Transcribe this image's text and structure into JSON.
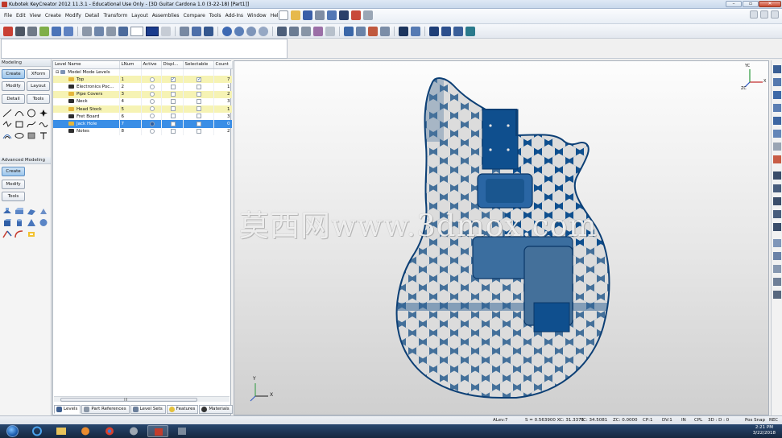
{
  "window": {
    "title": "Kubotek KeyCreator 2012 11.3.1 - Educational Use Only - [3D Guitar Cardona 1.0 (3-22-18) [Part1]]",
    "minimize_label": "–",
    "maximize_label": "▫",
    "close_label": "✕"
  },
  "menu": {
    "items": [
      "File",
      "Edit",
      "View",
      "Create",
      "Modify",
      "Detail",
      "Transform",
      "Layout",
      "Assemblies",
      "Compare",
      "Tools",
      "Add-Ins",
      "Window",
      "Help"
    ]
  },
  "palettes": {
    "modeling_header": "Modeling",
    "modeling_tabs": [
      "Create",
      "XForm",
      "Modify",
      "Layout",
      "Detail",
      "Tools"
    ],
    "advanced_header": "Advanced Modeling",
    "advanced_tabs": [
      "Create",
      "Modify",
      "Tools"
    ]
  },
  "levels": {
    "columns": [
      "Level Name",
      "LNum",
      "Active",
      "Displ...",
      "Selectable",
      "Count"
    ],
    "root_label": "Model Mode Levels",
    "rows": [
      {
        "name": "Top",
        "num": "1",
        "active": false,
        "display": true,
        "selectable": true,
        "count": "7",
        "highlight": true,
        "selected": false
      },
      {
        "name": "Electronics Poc...",
        "num": "2",
        "active": false,
        "display": false,
        "selectable": false,
        "count": "1",
        "highlight": false,
        "selected": false
      },
      {
        "name": "Pipe Covers",
        "num": "3",
        "active": false,
        "display": false,
        "selectable": false,
        "count": "2",
        "highlight": true,
        "selected": false
      },
      {
        "name": "Neck",
        "num": "4",
        "active": false,
        "display": false,
        "selectable": false,
        "count": "3",
        "highlight": false,
        "selected": false
      },
      {
        "name": "Head Stock",
        "num": "5",
        "active": false,
        "display": false,
        "selectable": false,
        "count": "1",
        "highlight": true,
        "selected": false
      },
      {
        "name": "Fret Board",
        "num": "6",
        "active": false,
        "display": false,
        "selectable": false,
        "count": "3",
        "highlight": false,
        "selected": false
      },
      {
        "name": "Jack Hole",
        "num": "7",
        "active": true,
        "display": false,
        "selectable": false,
        "count": "0",
        "highlight": false,
        "selected": true
      },
      {
        "name": "Notes",
        "num": "8",
        "active": false,
        "display": false,
        "selectable": false,
        "count": "2",
        "highlight": false,
        "selected": false
      }
    ],
    "scroll_grip": "III"
  },
  "bottom_tabs": [
    "Levels",
    "Part References",
    "Level Sets",
    "Features",
    "Materials"
  ],
  "viewport": {
    "watermark": "莫西网www.3dmox.com",
    "triad_x": "X",
    "triad_y": "Y",
    "triad_corner_x": "X",
    "triad_corner_y": "YC",
    "triad_corner_z": "ZC"
  },
  "status": {
    "alev": "ALev:7",
    "s": "S = 0.563900  XC: 31.3371",
    "yc": "YC: 34.5081",
    "zc": "ZC: 0.0000",
    "cp": "CP:1",
    "dv": "DV:1",
    "units": "IN",
    "cpl": "CPL",
    "mode": "3D : D : 0",
    "possnap": "Pos Snap",
    "rec": "REC"
  },
  "taskbar": {
    "time": "2:21 PM",
    "date": "3/22/2018"
  },
  "colors": {
    "guitar_blue": "#0f4f8e",
    "guitar_grey": "#44709a",
    "row_highlight": "#f6f3b4",
    "row_selected": "#3a8ee6"
  }
}
